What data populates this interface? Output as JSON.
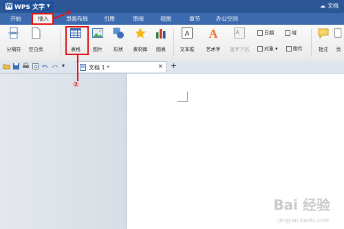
{
  "titlebar": {
    "app_name": "WPS 文字",
    "doc_link": "文档"
  },
  "menu": [
    {
      "label": "开始",
      "active": false
    },
    {
      "label": "插入",
      "active": true
    },
    {
      "label": "页面布局",
      "active": false
    },
    {
      "label": "引用",
      "active": false
    },
    {
      "label": "审阅",
      "active": false
    },
    {
      "label": "视图",
      "active": false
    },
    {
      "label": "章节",
      "active": false
    },
    {
      "label": "办公空间",
      "active": false
    }
  ],
  "ribbon": {
    "page_break": "分隔符",
    "blank_page": "空白页",
    "table": "表格",
    "picture": "图片",
    "shape": "形状",
    "material": "素材库",
    "chart": "图表",
    "textbox": "文本框",
    "wordart": "艺术字",
    "dropcap": "首字下沉",
    "date": "日期",
    "field": "域",
    "object": "对象",
    "attachment": "附件",
    "comment": "批注",
    "page": "页"
  },
  "tab": {
    "doc_title": "文档 1 *",
    "close": "×",
    "add": "+"
  },
  "annotations": {
    "num1": "①",
    "num2": "②",
    "color": "#e01010"
  },
  "colors": {
    "titlebar": "#2b5797",
    "menubar": "#3c6aaf",
    "accent": "#e01010"
  },
  "watermark": {
    "text": "Bai 经验",
    "url": "jingyan.baidu.com"
  }
}
